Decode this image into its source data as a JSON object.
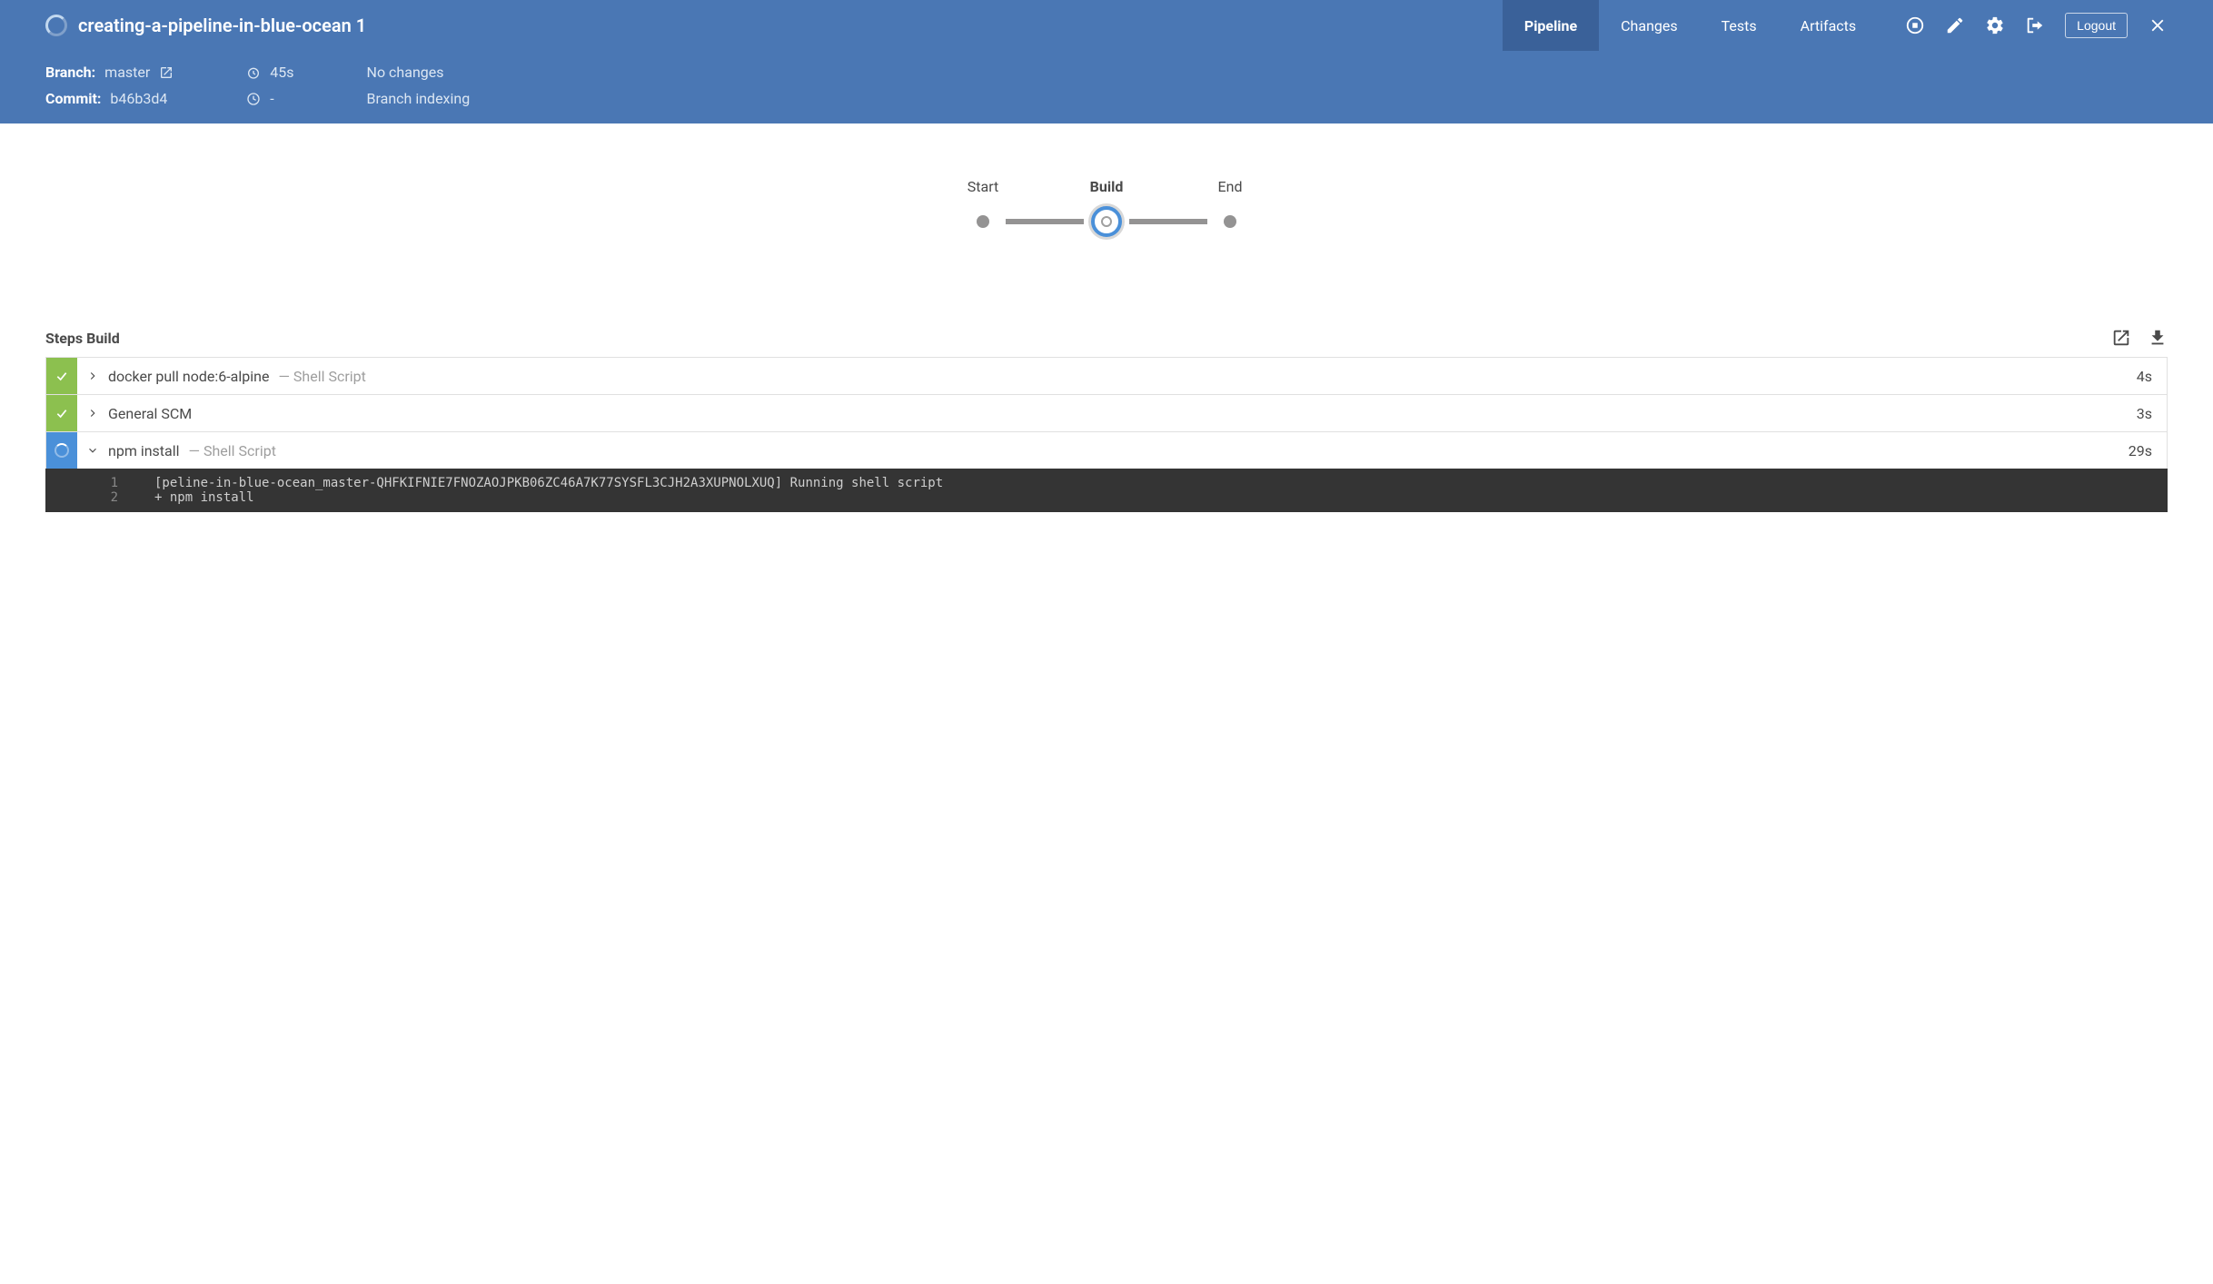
{
  "header": {
    "title": "creating-a-pipeline-in-blue-ocean 1",
    "tabs": [
      {
        "label": "Pipeline",
        "active": true
      },
      {
        "label": "Changes",
        "active": false
      },
      {
        "label": "Tests",
        "active": false
      },
      {
        "label": "Artifacts",
        "active": false
      }
    ],
    "logout": "Logout"
  },
  "info": {
    "branch_label": "Branch:",
    "branch_value": "master",
    "commit_label": "Commit:",
    "commit_value": "b46b3d4",
    "duration": "45s",
    "elapsed": "-",
    "changes": "No changes",
    "cause": "Branch indexing"
  },
  "stages": [
    {
      "label": "Start",
      "state": "done"
    },
    {
      "label": "Build",
      "state": "running"
    },
    {
      "label": "End",
      "state": "pending"
    }
  ],
  "steps_title": "Steps Build",
  "steps": [
    {
      "status": "success",
      "expanded": false,
      "name": "docker pull node:6-alpine",
      "type": "— Shell Script",
      "time": "4s"
    },
    {
      "status": "success",
      "expanded": false,
      "name": "General SCM",
      "type": "",
      "time": "3s"
    },
    {
      "status": "running",
      "expanded": true,
      "name": "npm install",
      "type": "— Shell Script",
      "time": "29s"
    }
  ],
  "console": [
    {
      "n": "1",
      "t": "[peline-in-blue-ocean_master-QHFKIFNIE7FNOZAOJPKB06ZC46A7K77SYSFL3CJH2A3XUPNOLXUQ] Running shell script"
    },
    {
      "n": "2",
      "t": "+ npm install"
    }
  ]
}
